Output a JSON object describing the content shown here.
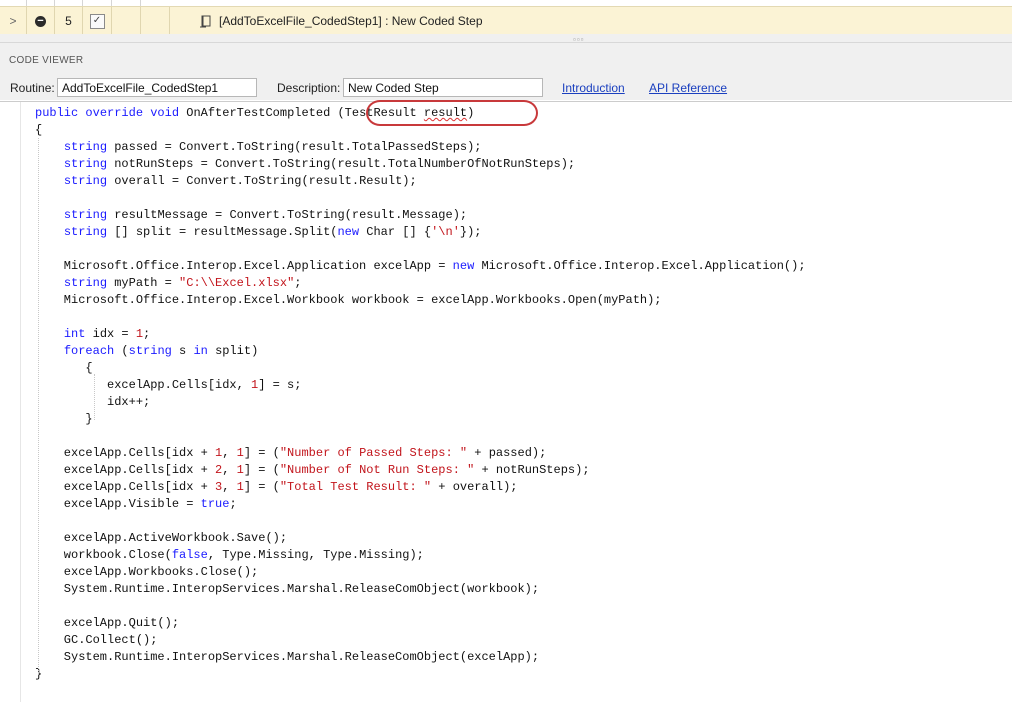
{
  "step_row": {
    "number": "5",
    "checked": true,
    "description": "[AddToExcelFile_CodedStep1] : New Coded Step"
  },
  "code_viewer": {
    "title": "CODE VIEWER",
    "routine_label": "Routine:",
    "routine_value": "AddToExcelFile_CodedStep1",
    "description_label": "Description:",
    "description_value": "New Coded Step",
    "links": [
      "Introduction",
      "API Reference"
    ]
  },
  "code": {
    "lines": [
      "public override void OnAfterTestCompleted (TestResult result)",
      "{",
      "    string passed = Convert.ToString(result.TotalPassedSteps);",
      "    string notRunSteps = Convert.ToString(result.TotalNumberOfNotRunSteps);",
      "    string overall = Convert.ToString(result.Result);",
      "",
      "    string resultMessage = Convert.ToString(result.Message);",
      "    string [] split = resultMessage.Split(new Char [] {'\\n'});",
      "",
      "    Microsoft.Office.Interop.Excel.Application excelApp = new Microsoft.Office.Interop.Excel.Application();",
      "    string myPath = \"C:\\\\Excel.xlsx\";",
      "    Microsoft.Office.Interop.Excel.Workbook workbook = excelApp.Workbooks.Open(myPath);",
      "",
      "    int idx = 1;",
      "    foreach (string s in split)",
      "       {",
      "          excelApp.Cells[idx, 1] = s;",
      "          idx++;",
      "       }",
      "",
      "    excelApp.Cells[idx + 1, 1] = (\"Number of Passed Steps: \" + passed);",
      "    excelApp.Cells[idx + 2, 1] = (\"Number of Not Run Steps: \" + notRunSteps);",
      "    excelApp.Cells[idx + 3, 1] = (\"Total Test Result: \" + overall);",
      "    excelApp.Visible = true;",
      "",
      "    excelApp.ActiveWorkbook.Save();",
      "    workbook.Close(false, Type.Missing, Type.Missing);",
      "    excelApp.Workbooks.Close();",
      "    System.Runtime.InteropServices.Marshal.ReleaseComObject(workbook);",
      "",
      "    excelApp.Quit();",
      "    GC.Collect();",
      "    System.Runtime.InteropServices.Marshal.ReleaseComObject(excelApp);",
      "}"
    ]
  },
  "colors": {
    "keyword": "#1a1aff",
    "string": "#c2151c",
    "highlight": "#c8393b",
    "row_background": "#fbf3d5",
    "link": "#1a3fbf"
  }
}
